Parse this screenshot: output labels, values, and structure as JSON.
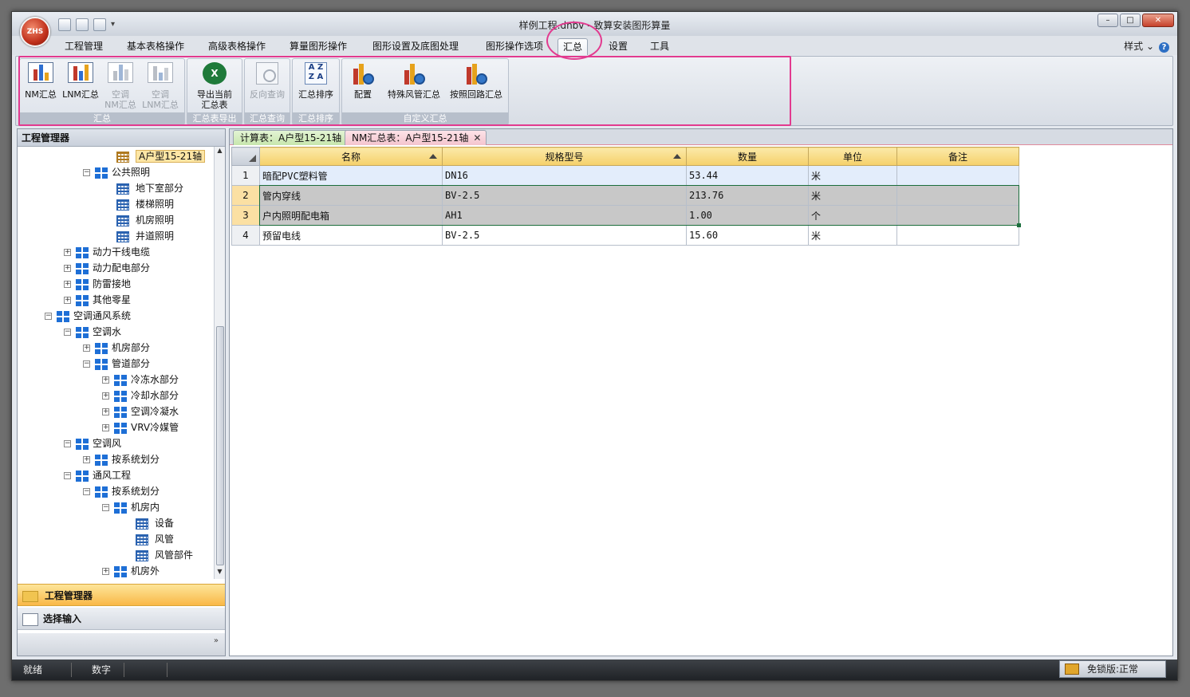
{
  "app": {
    "orb_label": "ZHS",
    "title": "样例工程.dnbv - 致算安装图形算量"
  },
  "ribbon_tabs": [
    "工程管理",
    "基本表格操作",
    "高级表格操作",
    "算量图形操作",
    "图形设置及底图处理",
    "图形操作选项",
    "汇总",
    "设置",
    "工具"
  ],
  "style_menu": "样式 ⌄",
  "ribbon": {
    "groups": [
      {
        "label": "汇总",
        "buttons": [
          "NM汇总",
          "LNM汇总",
          "空调\nNM汇总",
          "空调\nLNM汇总"
        ]
      },
      {
        "label": "汇总表导出",
        "buttons": [
          "导出当前\n汇总表"
        ]
      },
      {
        "label": "汇总查询",
        "buttons": [
          "反向查询"
        ]
      },
      {
        "label": "汇总排序",
        "buttons": [
          "汇总排序"
        ]
      },
      {
        "label": "自定义汇总",
        "buttons": [
          "配置",
          "特殊风管汇总",
          "按照回路汇总"
        ]
      }
    ]
  },
  "left_panel": {
    "title": "工程管理器",
    "tree": [
      "A户型15-21轴",
      "公共照明",
      "地下室部分",
      "楼梯照明",
      "机房照明",
      "井道照明",
      "动力干线电缆",
      "动力配电部分",
      "防雷接地",
      "其他零星",
      "空调通风系统",
      "空调水",
      "机房部分",
      "管道部分",
      "冷冻水部分",
      "冷却水部分",
      "空调冷凝水",
      "VRV冷媒管",
      "空调风",
      "按系统划分",
      "通风工程",
      "按系统划分",
      "机房内",
      "设备",
      "风管",
      "风管部件",
      "机房外"
    ],
    "nav": [
      "工程管理器",
      "选择输入"
    ]
  },
  "doc_tabs": [
    "计算表：A户型15-21轴",
    "NM汇总表：A户型15-21轴"
  ],
  "table": {
    "headers": [
      "名称",
      "规格型号",
      "数量",
      "单位",
      "备注"
    ],
    "rows": [
      {
        "no": "1",
        "name": "暗配PVC塑料管",
        "spec": "DN16",
        "qty": "53.44",
        "unit": "米",
        "note": ""
      },
      {
        "no": "2",
        "name": "管内穿线",
        "spec": "BV-2.5",
        "qty": "213.76",
        "unit": "米",
        "note": ""
      },
      {
        "no": "3",
        "name": "户内照明配电箱",
        "spec": "AH1",
        "qty": "1.00",
        "unit": "个",
        "note": ""
      },
      {
        "no": "4",
        "name": "预留电线",
        "spec": "BV-2.5",
        "qty": "15.60",
        "unit": "米",
        "note": ""
      }
    ]
  },
  "status": {
    "ready": "就绪",
    "num": "数字",
    "lock": "免锁版:正常"
  }
}
